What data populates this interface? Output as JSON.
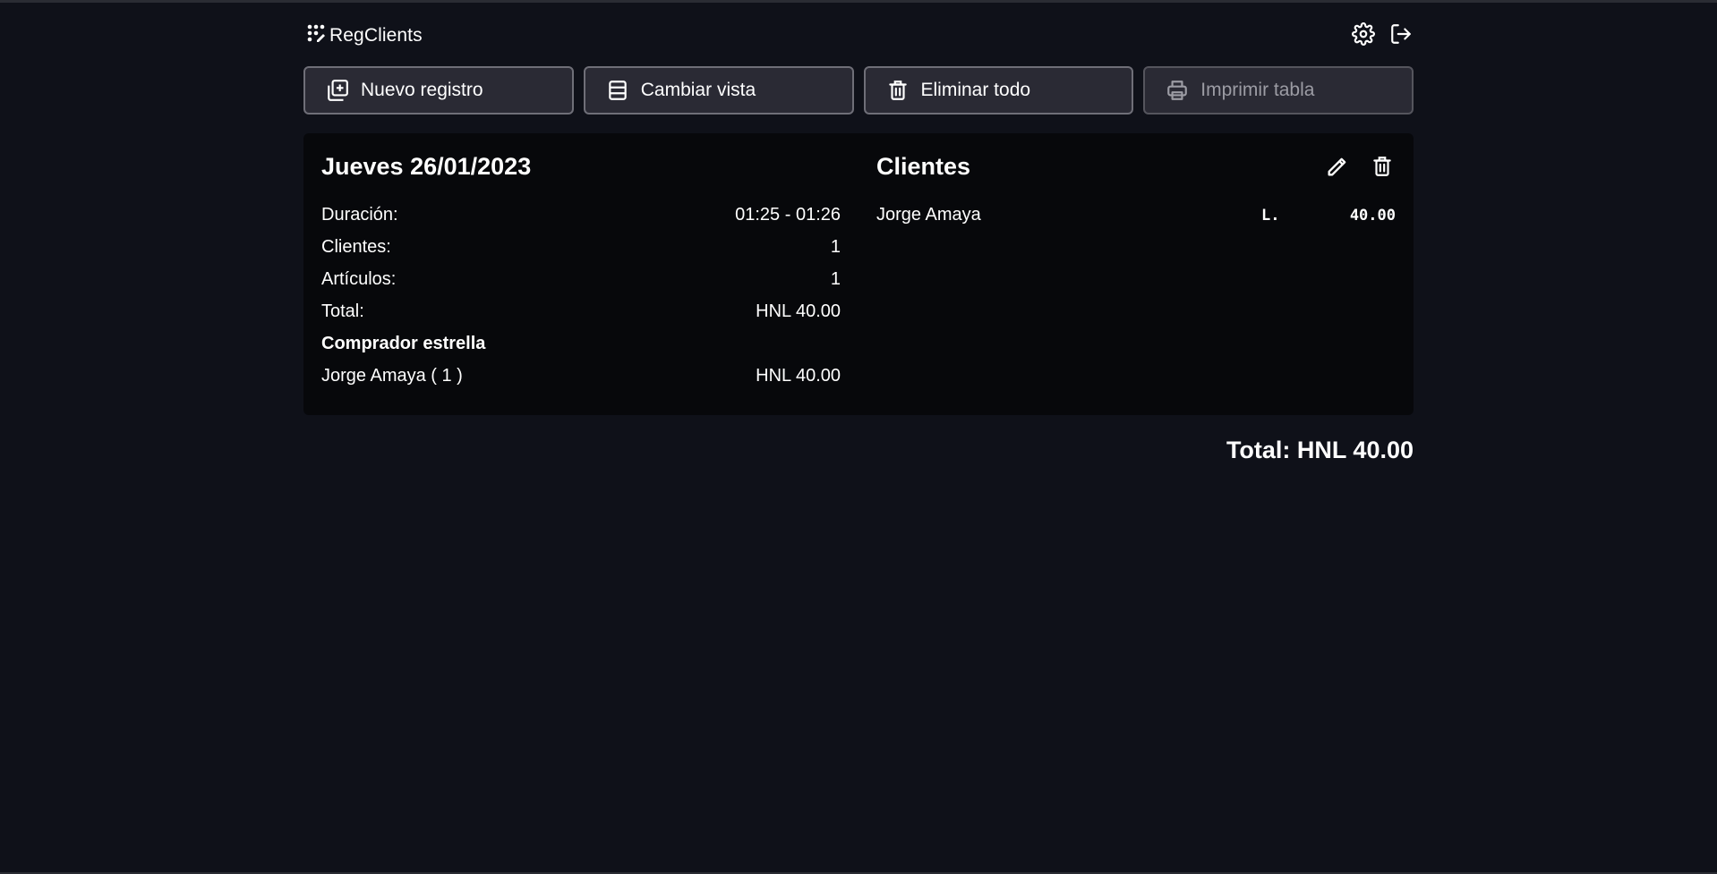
{
  "app": {
    "brand": "RegClients"
  },
  "header_icons": {
    "settings": "gear-icon",
    "logout": "logout-icon"
  },
  "toolbar": {
    "new_record": "Nuevo registro",
    "change_view": "Cambiar vista",
    "delete_all": "Eliminar todo",
    "print_table": "Imprimir tabla"
  },
  "record": {
    "title": "Jueves 26/01/2023",
    "stats": [
      {
        "label": "Duración:",
        "value": "01:25 - 01:26"
      },
      {
        "label": "Clientes:",
        "value": "1"
      },
      {
        "label": "Artículos:",
        "value": "1"
      },
      {
        "label": "Total:",
        "value": "HNL 40.00"
      }
    ],
    "star_heading": "Comprador estrella",
    "star_buyer": {
      "name": "Jorge Amaya ( 1 )",
      "value": "HNL 40.00"
    }
  },
  "clients": {
    "title": "Clientes",
    "items": [
      {
        "name": "Jorge Amaya",
        "currency": "L.",
        "amount": "40.00"
      }
    ]
  },
  "grand_total": "Total: HNL 40.00",
  "colors": {
    "background": "#0f1119",
    "card": "#07080b",
    "button": "#2a2a34",
    "button_border": "#6f6f78"
  }
}
